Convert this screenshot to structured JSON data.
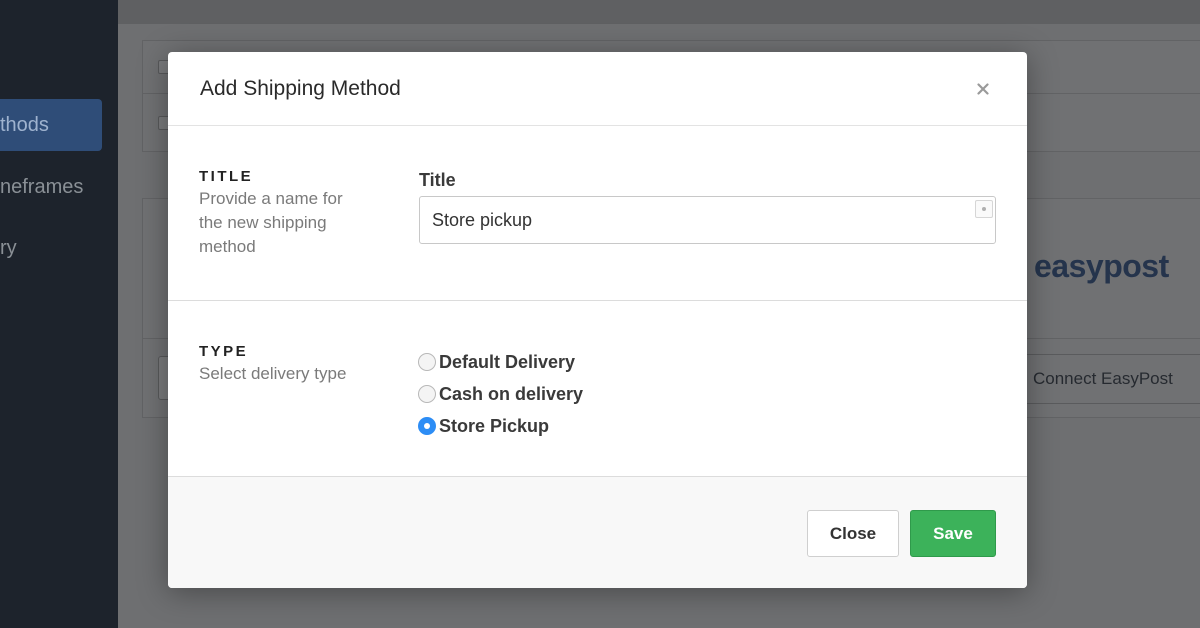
{
  "background": {
    "sidebar": {
      "items": [
        {
          "label": "thods",
          "active": true
        },
        {
          "label": "neframes",
          "active": false
        },
        {
          "label": "ry",
          "active": false
        }
      ]
    },
    "easypost_logo": "easypost",
    "connect_button": "Connect EasyPost"
  },
  "modal": {
    "title": "Add Shipping Method",
    "close_icon": "close-icon",
    "title_section": {
      "heading": "TITLE",
      "description": "Provide a name for the new shipping method",
      "field_label": "Title",
      "field_value": "Store pickup",
      "field_placeholder": ""
    },
    "type_section": {
      "heading": "TYPE",
      "description": "Select delivery type",
      "options": [
        {
          "label": "Default Delivery",
          "checked": false
        },
        {
          "label": "Cash on delivery",
          "checked": false
        },
        {
          "label": "Store Pickup",
          "checked": true
        }
      ]
    },
    "footer": {
      "close_label": "Close",
      "save_label": "Save"
    }
  },
  "colors": {
    "accent_blue": "#2d8df5",
    "save_green": "#3cb25a",
    "sidebar_bg": "#1d232c"
  }
}
